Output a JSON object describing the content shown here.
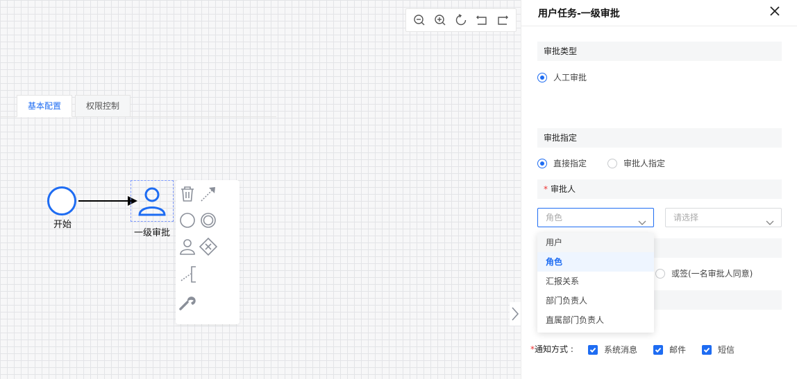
{
  "canvas": {
    "start_node_label": "开始",
    "user_task_label": "一级审批",
    "toolbar": [
      "zoom-out-icon",
      "zoom-in-icon",
      "reset-icon",
      "undo-icon",
      "redo-icon"
    ]
  },
  "panel": {
    "title": "用户任务-一级审批",
    "approval_type": {
      "section": "审批类型",
      "option": "人工审批"
    },
    "tabs": {
      "basic": "基本配置",
      "permission": "权限控制"
    },
    "assign": {
      "section": "审批指定",
      "option_direct": "直接指定",
      "option_approver": "审批人指定"
    },
    "approver": {
      "required": "*",
      "section": "审批人",
      "select_type_value": "角色",
      "select_target_placeholder": "请选择",
      "dropdown_options": [
        "用户",
        "角色",
        "汇报关系",
        "部门负责人",
        "直属部门负责人"
      ]
    },
    "sign": {
      "or_sign_option": "或签(一名审批人同意)"
    },
    "notify": {
      "required": "*",
      "label": "通知方式 :",
      "options": [
        "系统消息",
        "邮件",
        "短信"
      ]
    }
  },
  "colors": {
    "accent": "#1e6cf2",
    "required": "#e33333"
  }
}
